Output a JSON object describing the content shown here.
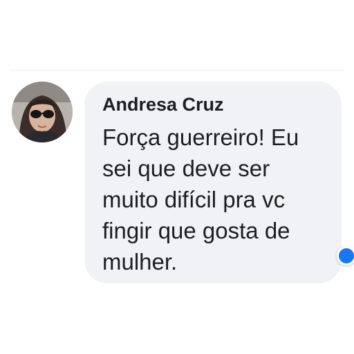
{
  "comment": {
    "author": "Andresa Cruz",
    "text_lines": [
      "Força guerreiro! Eu",
      "sei que deve ser",
      "muito difícil pra vc",
      "fingir que gosta de",
      "mulher."
    ],
    "avatar_icon": "profile-photo",
    "reaction_icon": "like-reaction-icon"
  },
  "colors": {
    "bubble": "#f0f2f5",
    "text": "#1c1e21",
    "reaction": "#1877f2"
  }
}
